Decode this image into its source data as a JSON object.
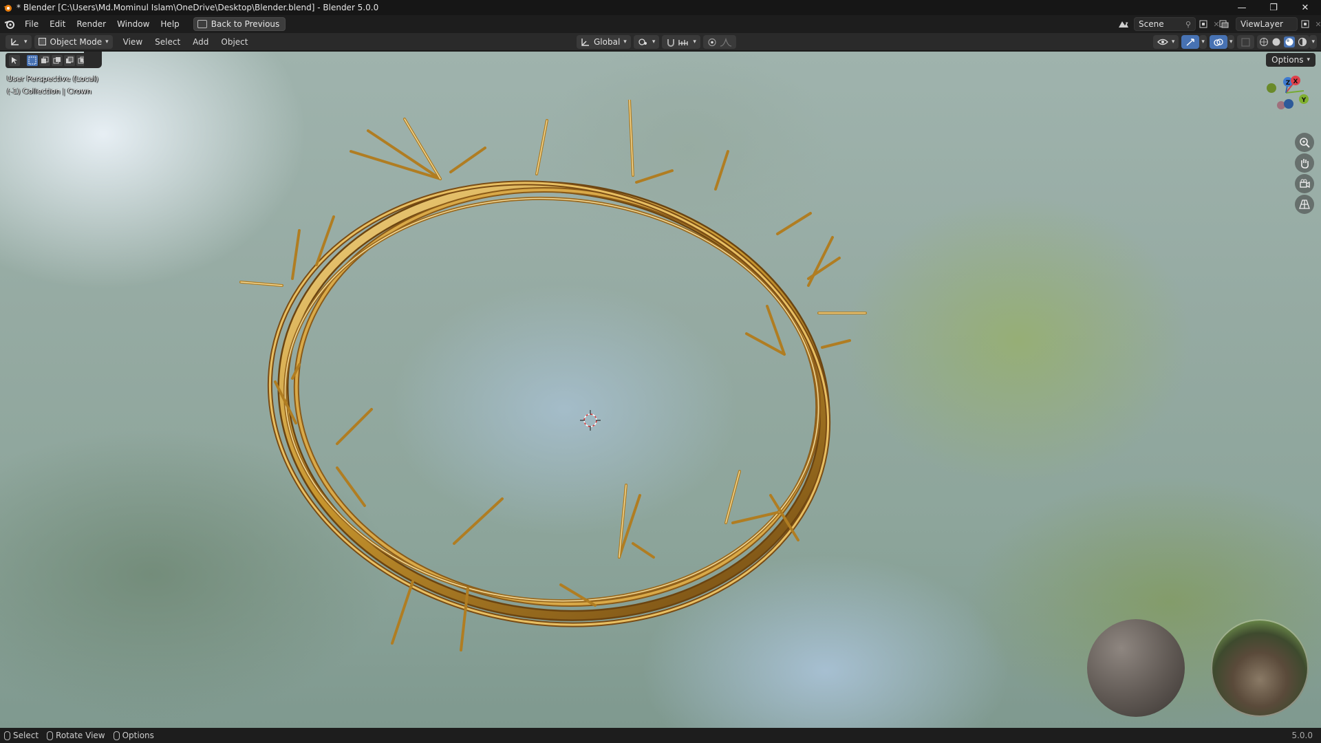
{
  "window": {
    "title": "* Blender [C:\\Users\\Md.Mominul Islam\\OneDrive\\Desktop\\Blender.blend] - Blender 5.0.0",
    "minimize": "—",
    "maximize": "❐",
    "close": "✕"
  },
  "menubar": {
    "items": [
      "File",
      "Edit",
      "Render",
      "Window",
      "Help"
    ],
    "back_button": "Back to Previous",
    "scene": "Scene",
    "view_layer": "ViewLayer"
  },
  "header": {
    "mode": "Object Mode",
    "menus": [
      "View",
      "Select",
      "Add",
      "Object"
    ],
    "orientation": "Global"
  },
  "viewport": {
    "info_line1": "User Perspective (Local)",
    "info_line2": "(-1) Collection | Crown",
    "options_label": "Options",
    "gizmo": {
      "x_label": "X",
      "y_label": "Y",
      "z_label": "Z"
    },
    "colors": {
      "gold": "#c8962e",
      "gold_highlight": "#f2d58a",
      "gold_shadow": "#6b4410"
    }
  },
  "statusbar": {
    "select": "Select",
    "rotate": "Rotate View",
    "options": "Options",
    "version": "5.0.0"
  }
}
